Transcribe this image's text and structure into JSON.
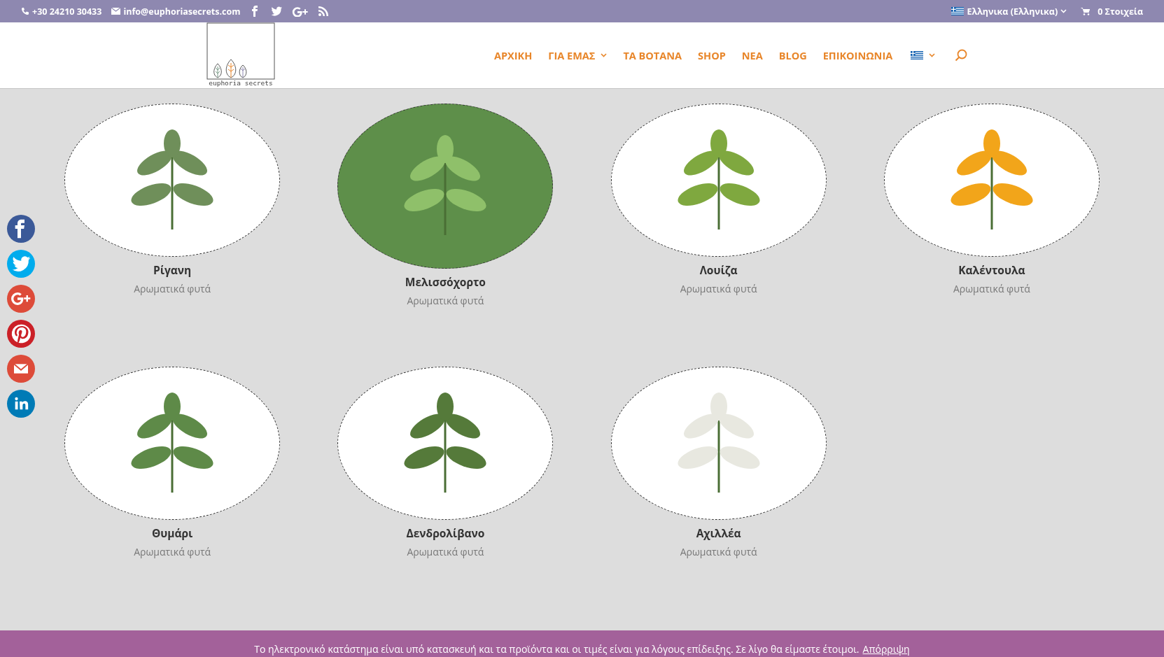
{
  "top_bar": {
    "phone": "+30 24210 30433",
    "email": "info@euphoriasecrets.com",
    "language": "Ελληνικα (Ελληνικα)",
    "cart": "0 Στοιχεία"
  },
  "header": {
    "logo_text": "euphoria secrets",
    "nav": [
      {
        "label": "ΑΡΧΙΚΗ",
        "has_submenu": false
      },
      {
        "label": "ΓΙΑ ΕΜΑΣ",
        "has_submenu": true
      },
      {
        "label": "ΤΑ ΒΟΤΑΝΑ",
        "has_submenu": false
      },
      {
        "label": "SHOP",
        "has_submenu": false
      },
      {
        "label": "ΝΕΑ",
        "has_submenu": false
      },
      {
        "label": "BLOG",
        "has_submenu": false
      },
      {
        "label": "ΕΠΙΚΟΙΝΩΝΙΑ",
        "has_submenu": false
      }
    ]
  },
  "products": [
    {
      "name": "Ρίγανη",
      "category": "Αρωματικά φυτά",
      "hovered": false
    },
    {
      "name": "Μελισσόχορτο",
      "category": "Αρωματικά φυτά",
      "hovered": true
    },
    {
      "name": "Λουίζα",
      "category": "Αρωματικά φυτά",
      "hovered": false
    },
    {
      "name": "Καλέντουλα",
      "category": "Αρωματικά φυτά",
      "hovered": false
    },
    {
      "name": "Θυμάρι",
      "category": "Αρωματικά φυτά",
      "hovered": false
    },
    {
      "name": "Δενδρολίβανο",
      "category": "Αρωματικά φυτά",
      "hovered": false
    },
    {
      "name": "Αχιλλέα",
      "category": "Αρωματικά φυτά",
      "hovered": false
    }
  ],
  "share_buttons": [
    {
      "kind": "facebook",
      "color": "#3b5998"
    },
    {
      "kind": "twitter",
      "color": "#00aced"
    },
    {
      "kind": "googleplus",
      "color": "#dd4b39"
    },
    {
      "kind": "pinterest",
      "color": "#cb2027"
    },
    {
      "kind": "email",
      "color": "#dd4b39"
    },
    {
      "kind": "linkedin",
      "color": "#007bb6"
    }
  ],
  "notice": {
    "text": "Το ηλεκτρονικό κατάστημα είναι υπό κατασκευή και τα προϊόντα και οι τιμές είναι για λόγους επίδειξης. Σε λίγο θα είμαστε έτοιμοι.",
    "dismiss": "Απόρριψη"
  }
}
